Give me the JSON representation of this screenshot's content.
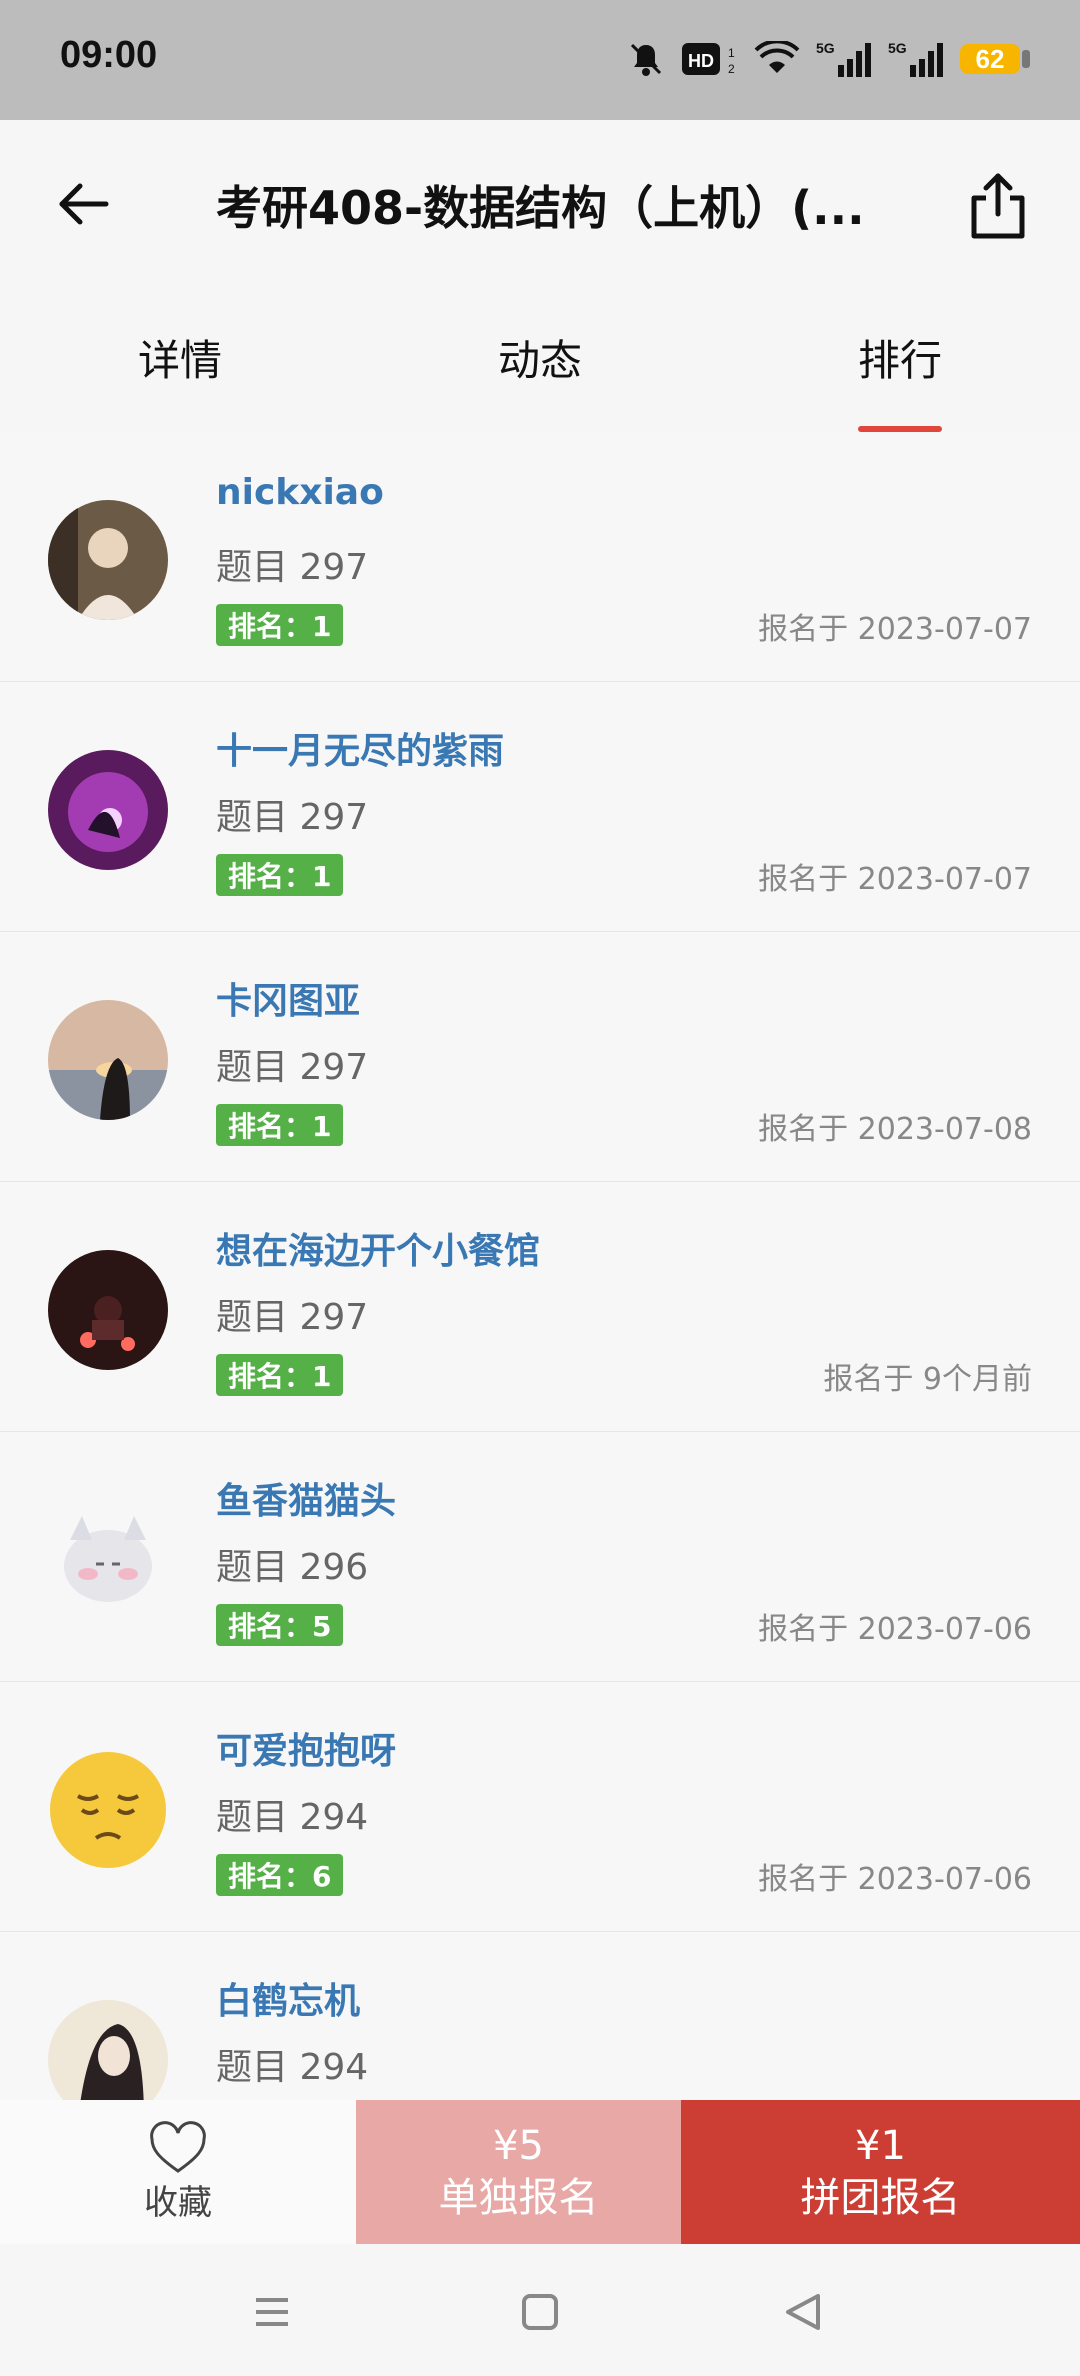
{
  "status_bar": {
    "time": "09:00",
    "battery": "62",
    "icons": [
      "mute-icon",
      "hd-icon",
      "wifi-icon",
      "5g-signal-icon",
      "5g-signal-icon",
      "battery-icon"
    ]
  },
  "header": {
    "title": "考研408-数据结构（上机）(..."
  },
  "tabs": [
    {
      "label": "详情",
      "active": false
    },
    {
      "label": "动态",
      "active": false
    },
    {
      "label": "排行",
      "active": true
    }
  ],
  "colors": {
    "accent": "#e0463c",
    "name": "#3a78b3",
    "rank_badge": "#55b047",
    "single_btn": "#e7a8a6",
    "group_btn": "#cc3e33"
  },
  "ranking": [
    {
      "name": "nickxiao",
      "count": "题目 297",
      "rank": "排名：1",
      "signup": "报名于 2023-07-07"
    },
    {
      "name": "十一月无尽的紫雨",
      "count": "题目 297",
      "rank": "排名：1",
      "signup": "报名于 2023-07-07"
    },
    {
      "name": "卡冈图亚",
      "count": "题目 297",
      "rank": "排名：1",
      "signup": "报名于 2023-07-08"
    },
    {
      "name": "想在海边开个小餐馆",
      "count": "题目 297",
      "rank": "排名：1",
      "signup": "报名于 9个月前"
    },
    {
      "name": "鱼香猫猫头",
      "count": "题目 296",
      "rank": "排名：5",
      "signup": "报名于 2023-07-06"
    },
    {
      "name": "可爱抱抱呀",
      "count": "题目 294",
      "rank": "排名：6",
      "signup": "报名于 2023-07-06"
    },
    {
      "name": "白鹤忘机",
      "count": "题目 294",
      "rank": "",
      "signup": ""
    }
  ],
  "actions": {
    "favorite_label": "收藏",
    "single_price": "¥5",
    "single_label": "单独报名",
    "group_price": "¥1",
    "group_label": "拼团报名"
  }
}
